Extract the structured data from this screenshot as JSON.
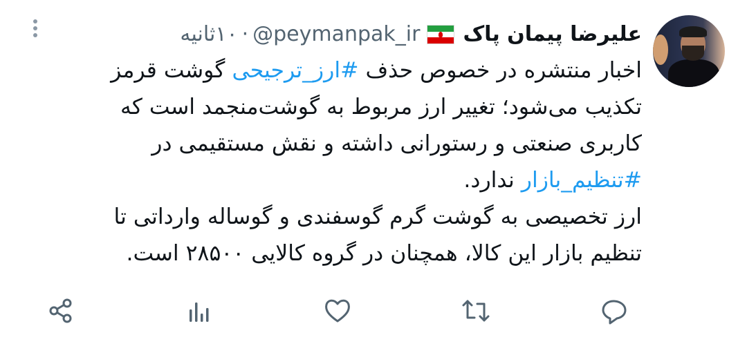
{
  "tweet": {
    "author_name": "علیرضا پیمان پاک",
    "handle": "@peymanpak_ir",
    "separator": "·",
    "time": "۱۰ثانیه",
    "lines": [
      [
        "اخبار منتشره در خصوص حذف ",
        {
          "hashtag": "#ارز_ترجیحی"
        },
        " گوشت قرمز"
      ],
      [
        "تکذیب می‌شود؛ تغییر ارز مربوط به گوشت‌منجمد است که"
      ],
      [
        "کاربری صنعتی و رستورانی داشته و نقش مستقیمی در"
      ],
      [
        {
          "hashtag": "#تنظیم_بازار"
        },
        " ندارد."
      ],
      [
        "ارز تخصیصی به گوشت گرم گوسفندی و گوساله وارداتی تا"
      ],
      [
        "تنظیم بازار این کالا، همچنان در گروه کالایی ۲۸۵۰۰ است."
      ]
    ]
  },
  "actions": {
    "reply": "reply-icon",
    "retweet": "retweet-icon",
    "like": "heart-icon",
    "views": "views-icon",
    "share": "share-icon"
  },
  "colors": {
    "text": "#0f1419",
    "secondary": "#536471",
    "link": "#1d9bf0",
    "icon": "#536471"
  }
}
